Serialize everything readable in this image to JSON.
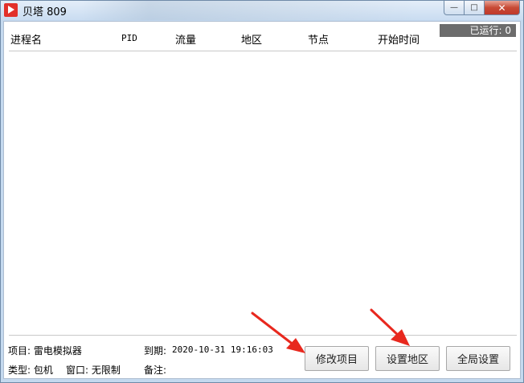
{
  "window": {
    "title": "贝塔 809",
    "min_glyph": "—",
    "max_glyph": "□",
    "close_glyph": "✕"
  },
  "status": {
    "run_count": "已运行: 0"
  },
  "table": {
    "columns": [
      "进程名",
      "PID",
      "流量",
      "地区",
      "节点",
      "开始时间"
    ],
    "rows": []
  },
  "info": {
    "project": "项目: 雷电模拟器",
    "type": "类型: 包机",
    "window": "窗口: 无限制",
    "expiry_label": "到期:",
    "expiry_value": "2020-10-31 19:16:03",
    "note": "备注:"
  },
  "buttons": {
    "edit_project": "修改项目",
    "set_region": "设置地区",
    "global_settings": "全局设置"
  },
  "colors": {
    "arrow": "#e8281e",
    "icon": "#e2302a",
    "counter_bg": "#6c6c6c"
  }
}
